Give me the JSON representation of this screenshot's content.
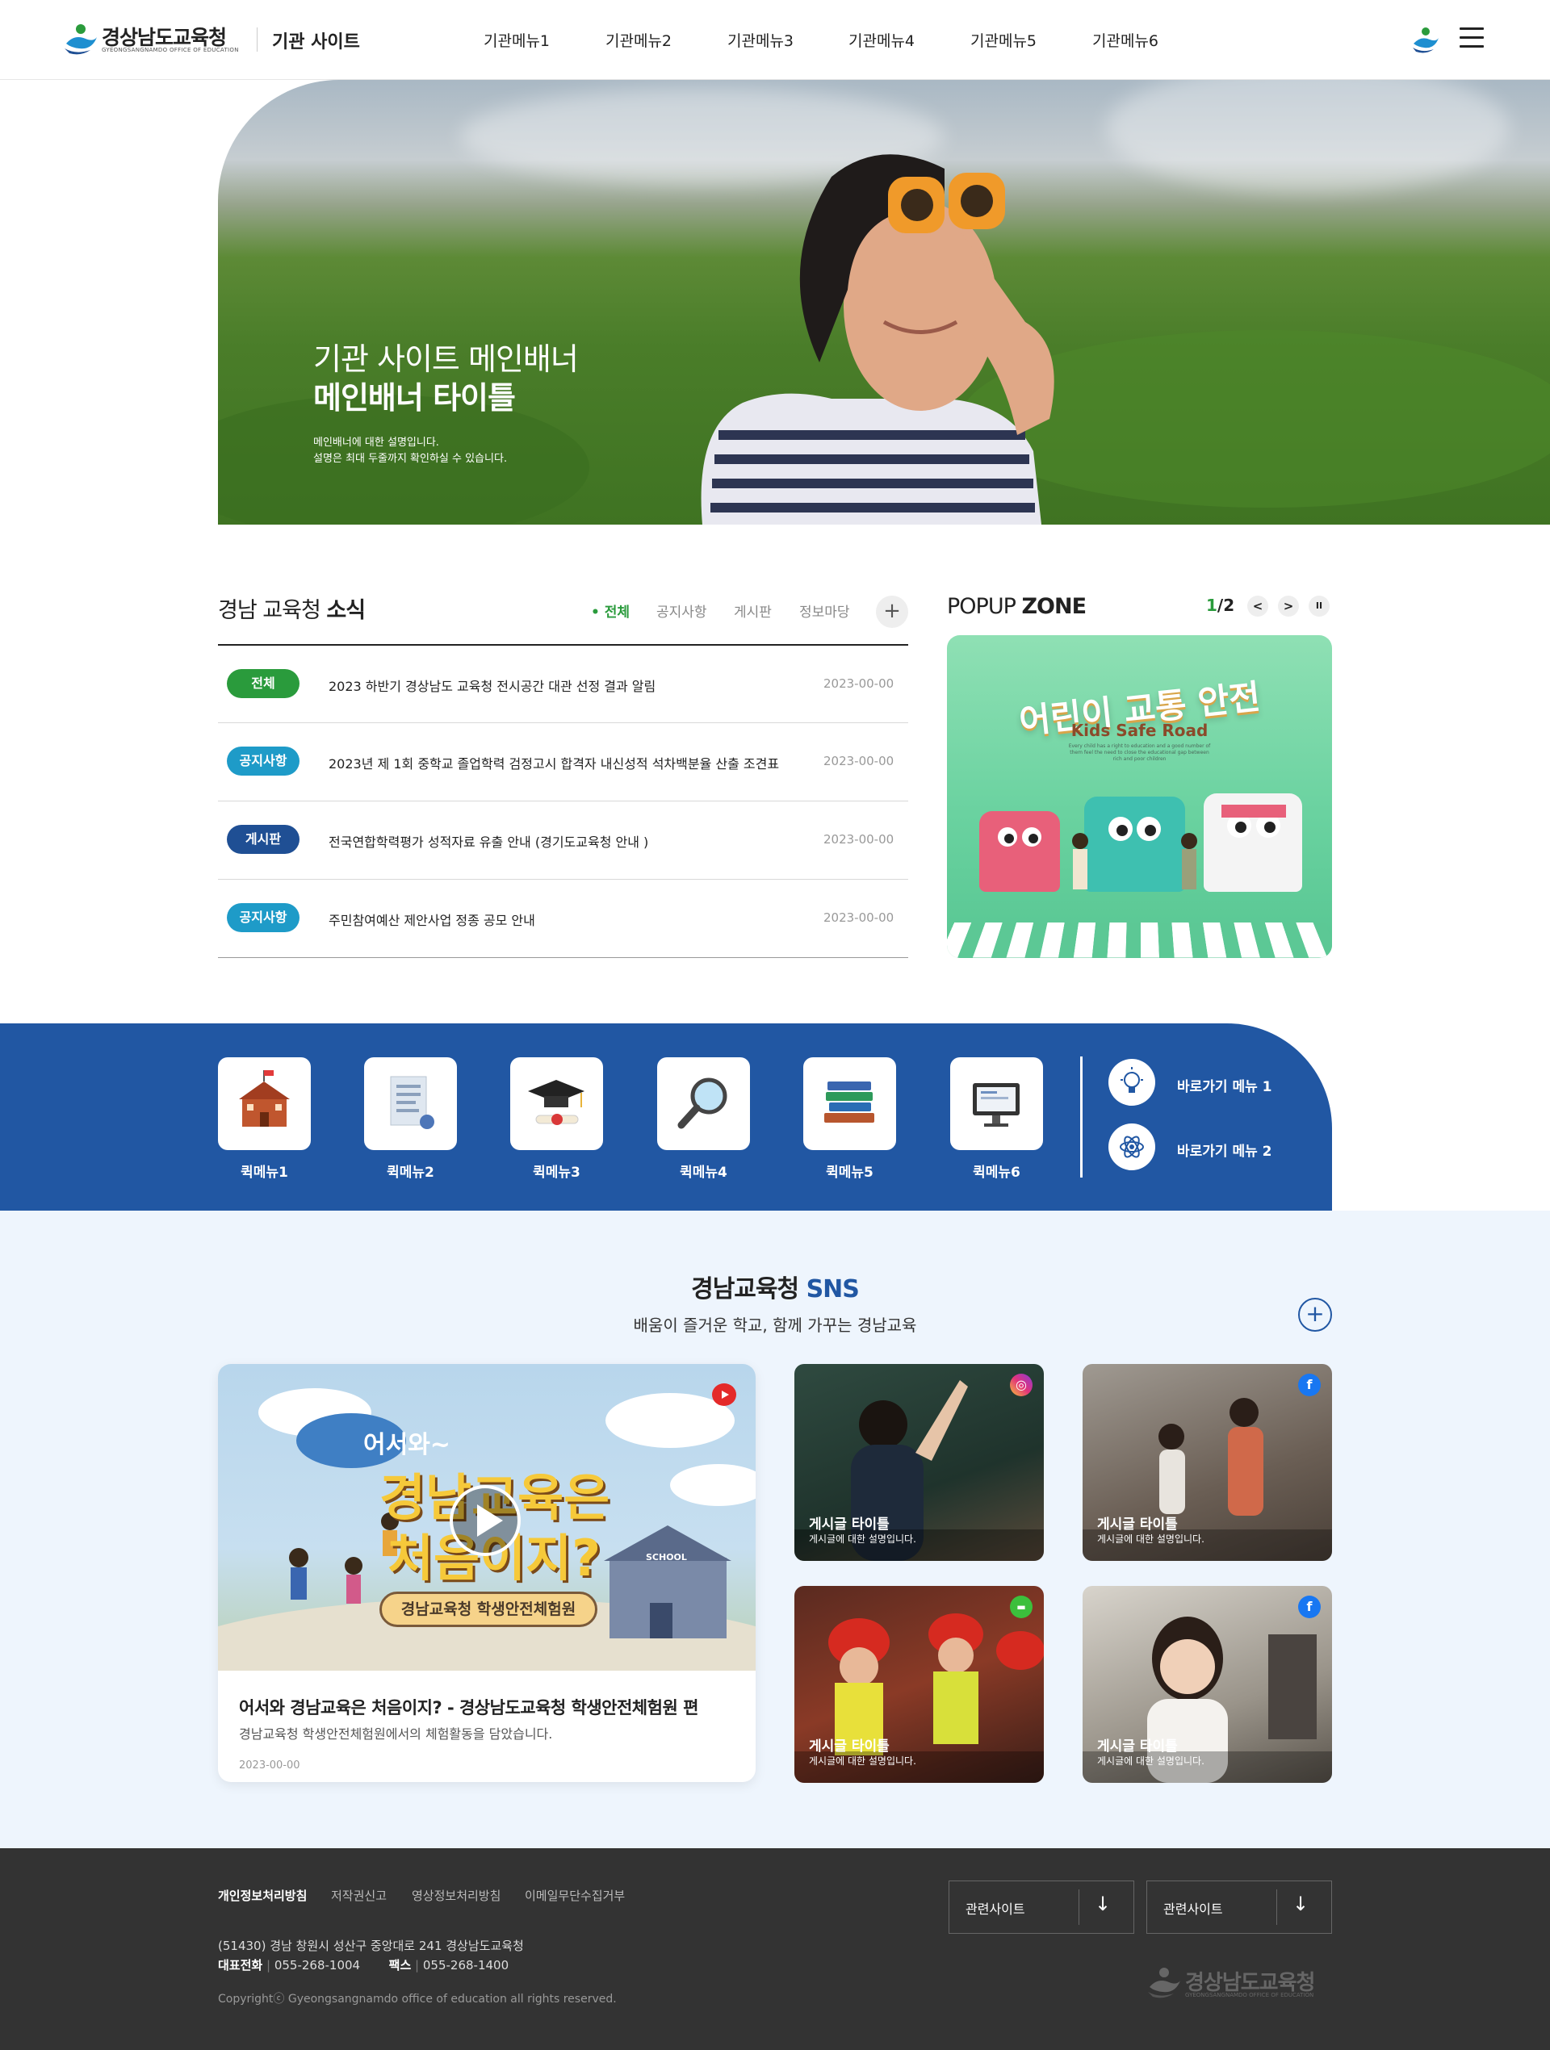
{
  "header": {
    "logo_text": "경상남도교육청",
    "logo_sub": "GYEONGSANGNAMDO OFFICE OF EDUCATION",
    "site_name": "기관 사이트",
    "nav": [
      "기관메뉴1",
      "기관메뉴2",
      "기관메뉴3",
      "기관메뉴4",
      "기관메뉴5",
      "기관메뉴6"
    ]
  },
  "hero": {
    "title_line1": "기관 사이트 메인배너",
    "title_line2": "메인배너 타이틀",
    "desc_line1": "메인배너에 대한 설명입니다.",
    "desc_line2": "설명은 최대 두줄까지 확인하실 수 있습니다."
  },
  "news": {
    "title_normal": "경남 교육청 ",
    "title_bold": "소식",
    "tabs": [
      "• 전체",
      "공지사항",
      "게시판",
      "정보마당"
    ],
    "more": "+",
    "items": [
      {
        "badge": "전체",
        "badge_color": "#2a9b3c",
        "text": "2023 하반기 경상남도 교육청 전시공간 대관 선정 결과 알림",
        "date": "2023-00-00"
      },
      {
        "badge": "공지사항",
        "badge_color": "#1e9bc8",
        "text": "2023년 제 1회 중학교 졸업학력 검정고시 합격자 내신성적 석차백분율 산출 조견표",
        "date": "2023-00-00"
      },
      {
        "badge": "게시판",
        "badge_color": "#1f4f94",
        "text": "전국연합학력평가 성적자료 유출 안내 (경기도교육청 안내 )",
        "date": "2023-00-00"
      },
      {
        "badge": "공지사항",
        "badge_color": "#1e9bc8",
        "text": "주민참여예산 제안사업 정종 공모 안내",
        "date": "2023-00-00"
      }
    ]
  },
  "popup": {
    "title_normal": "POPUP ",
    "title_bold": "ZONE",
    "page_current": "1",
    "page_total": "/2",
    "prev": "<",
    "next": ">",
    "pause": "II",
    "banner_title": "어린이 교통 안전",
    "banner_sub": "Kids Safe Road",
    "banner_small": "Every child has a right to education and a good number of them feel the need to close the educational gap between rich and poor children"
  },
  "quick": {
    "items": [
      {
        "label": "퀵메뉴1",
        "icon": "school-icon"
      },
      {
        "label": "퀵메뉴2",
        "icon": "document-icon"
      },
      {
        "label": "퀵메뉴3",
        "icon": "graduation-cap-icon"
      },
      {
        "label": "퀵메뉴4",
        "icon": "magnifier-icon"
      },
      {
        "label": "퀵메뉴5",
        "icon": "books-icon"
      },
      {
        "label": "퀵메뉴6",
        "icon": "monitor-icon"
      }
    ],
    "links": [
      {
        "label": "바로가기 메뉴 1",
        "icon": "lightbulb-icon"
      },
      {
        "label": "바로가기 메뉴 2",
        "icon": "atom-icon"
      }
    ]
  },
  "sns": {
    "title_normal": "경남교육청 ",
    "title_accent": "SNS",
    "subtitle": "배움이 즐거운 학교, 함께 가꾸는 경남교육",
    "more": "+",
    "video": {
      "thumb_line1": "어서와~",
      "thumb_line2": "경남교육은",
      "thumb_line3": "처음이지?",
      "thumb_banner": "경남교육청 학생안전체험원",
      "thumb_school": "SCHOOL",
      "title": "어서와 경남교육은 처음이지? - 경상남도교육청 학생안전체험원 편",
      "desc": "경남교육청 학생안전체험원에서의 체험활동을 담았습니다.",
      "date": "2023-00-00"
    },
    "cards": [
      {
        "title": "게시글 타이틀",
        "desc": "게시글에 대한 설명입니다.",
        "platform": "instagram-icon"
      },
      {
        "title": "게시글 타이틀",
        "desc": "게시글에 대한 설명입니다.",
        "platform": "facebook-icon"
      },
      {
        "title": "게시글 타이틀",
        "desc": "게시글에 대한 설명입니다.",
        "platform": "talk-icon"
      },
      {
        "title": "게시글 타이틀",
        "desc": "게시글에 대한 설명입니다.",
        "platform": "facebook-icon"
      }
    ]
  },
  "footer": {
    "links": [
      "개인정보처리방침",
      "저작권신고",
      "영상정보처리방침",
      "이메일무단수집거부"
    ],
    "address": "(51430) 경남 창원시 성산구 중앙대로 241 경상남도교육청",
    "tel_label": "대표전화",
    "tel": "055-268-1004",
    "fax_label": "팩스",
    "fax": "055-268-1400",
    "copyright": "Copyrightⓒ Gyeongsangnamdo office of education all rights reserved.",
    "related1": "관련사이트",
    "related2": "관련사이트",
    "logo_text": "경상남도교육청",
    "logo_sub": "GYEONGSANGNAMDO OFFICE OF EDUCATION"
  }
}
